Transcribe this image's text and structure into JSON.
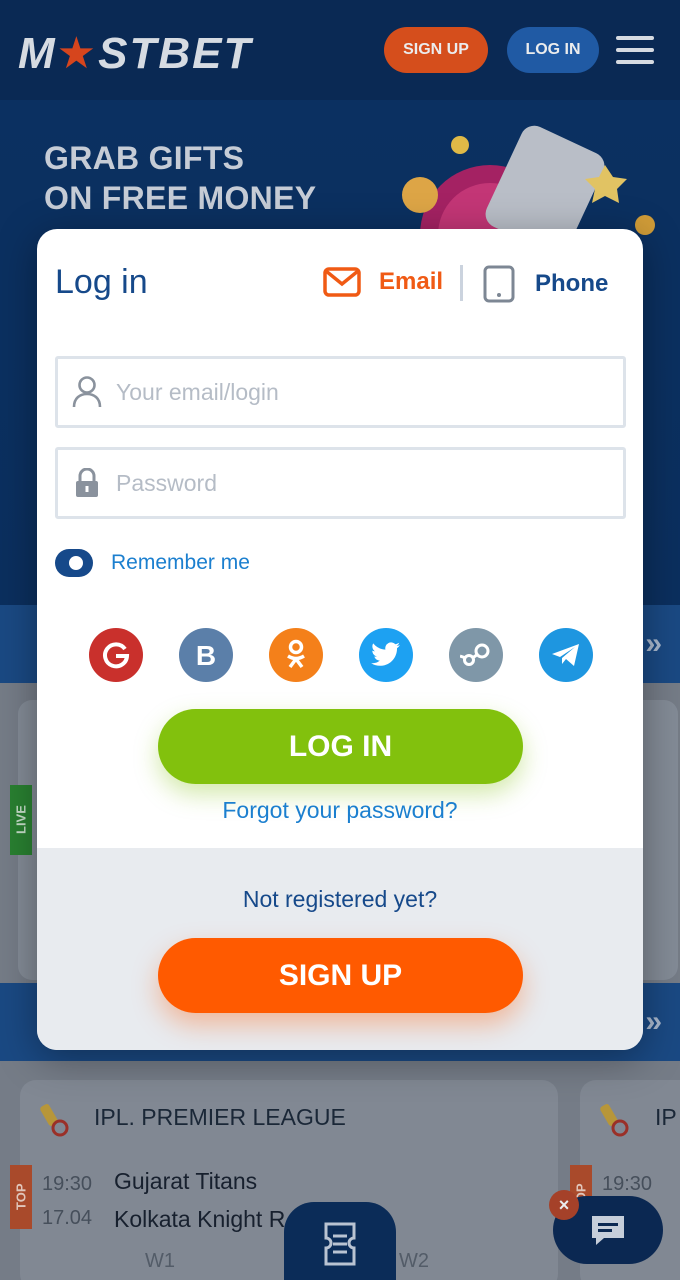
{
  "header": {
    "logo_text_left": "M",
    "logo_star": "★",
    "logo_text_right": "STBET",
    "signup_label": "SIGN UP",
    "login_label": "LOG IN"
  },
  "promo": {
    "title_line1": "GRAB GIFTS",
    "title_line2": "ON FREE MONEY"
  },
  "background": {
    "live_tag": "LIVE",
    "top_tag": "TOP",
    "league": "IPL. PREMIER LEAGUE",
    "league_cut": "IP",
    "match": {
      "time1": "19:30",
      "date1": "17.04",
      "team1": "Gujarat Titans",
      "team2": "Kolkata Knight R",
      "odd_w1": "W1",
      "odd_w2": "W2"
    },
    "chat_close": "×"
  },
  "modal": {
    "title": "Log in",
    "tabs": {
      "email": "Email",
      "phone": "Phone"
    },
    "email_placeholder": "Your email/login",
    "password_placeholder": "Password",
    "remember_label": "Remember me",
    "socials": [
      "google-icon",
      "vk-icon",
      "odnoklassniki-icon",
      "twitter-icon",
      "steam-icon",
      "telegram-icon"
    ],
    "login_button": "LOG IN",
    "forgot_link": "Forgot your password?",
    "not_registered": "Not registered yet?",
    "signup_button": "SIGN UP"
  },
  "colors": {
    "brand_blue": "#16498a",
    "link_blue": "#1b7fcf",
    "accent_orange": "#ff5a00",
    "login_green": "#82c10d"
  }
}
